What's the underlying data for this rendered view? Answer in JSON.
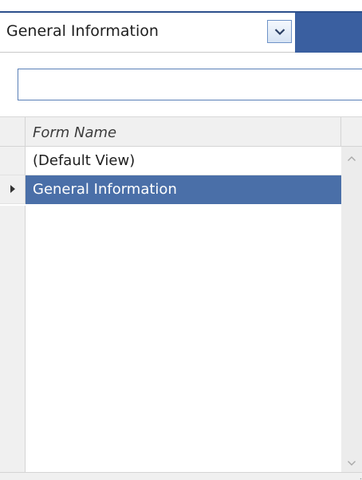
{
  "form_selector": {
    "selected": "General Information"
  },
  "filter": {
    "value": "",
    "placeholder": ""
  },
  "grid": {
    "column_header": "Form Name",
    "rows": [
      {
        "label": "(Default View)",
        "selected": false
      },
      {
        "label": "General Information",
        "selected": true
      }
    ]
  },
  "colors": {
    "selection": "#4a6fa8",
    "accent_bar": "#3a5fa0",
    "header_bg": "#f0f0f0"
  },
  "icons": {
    "dropdown": "chevron-down-icon",
    "current_row": "row-pointer-icon",
    "scroll_up": "scroll-up-icon",
    "scroll_down": "scroll-down-icon"
  }
}
